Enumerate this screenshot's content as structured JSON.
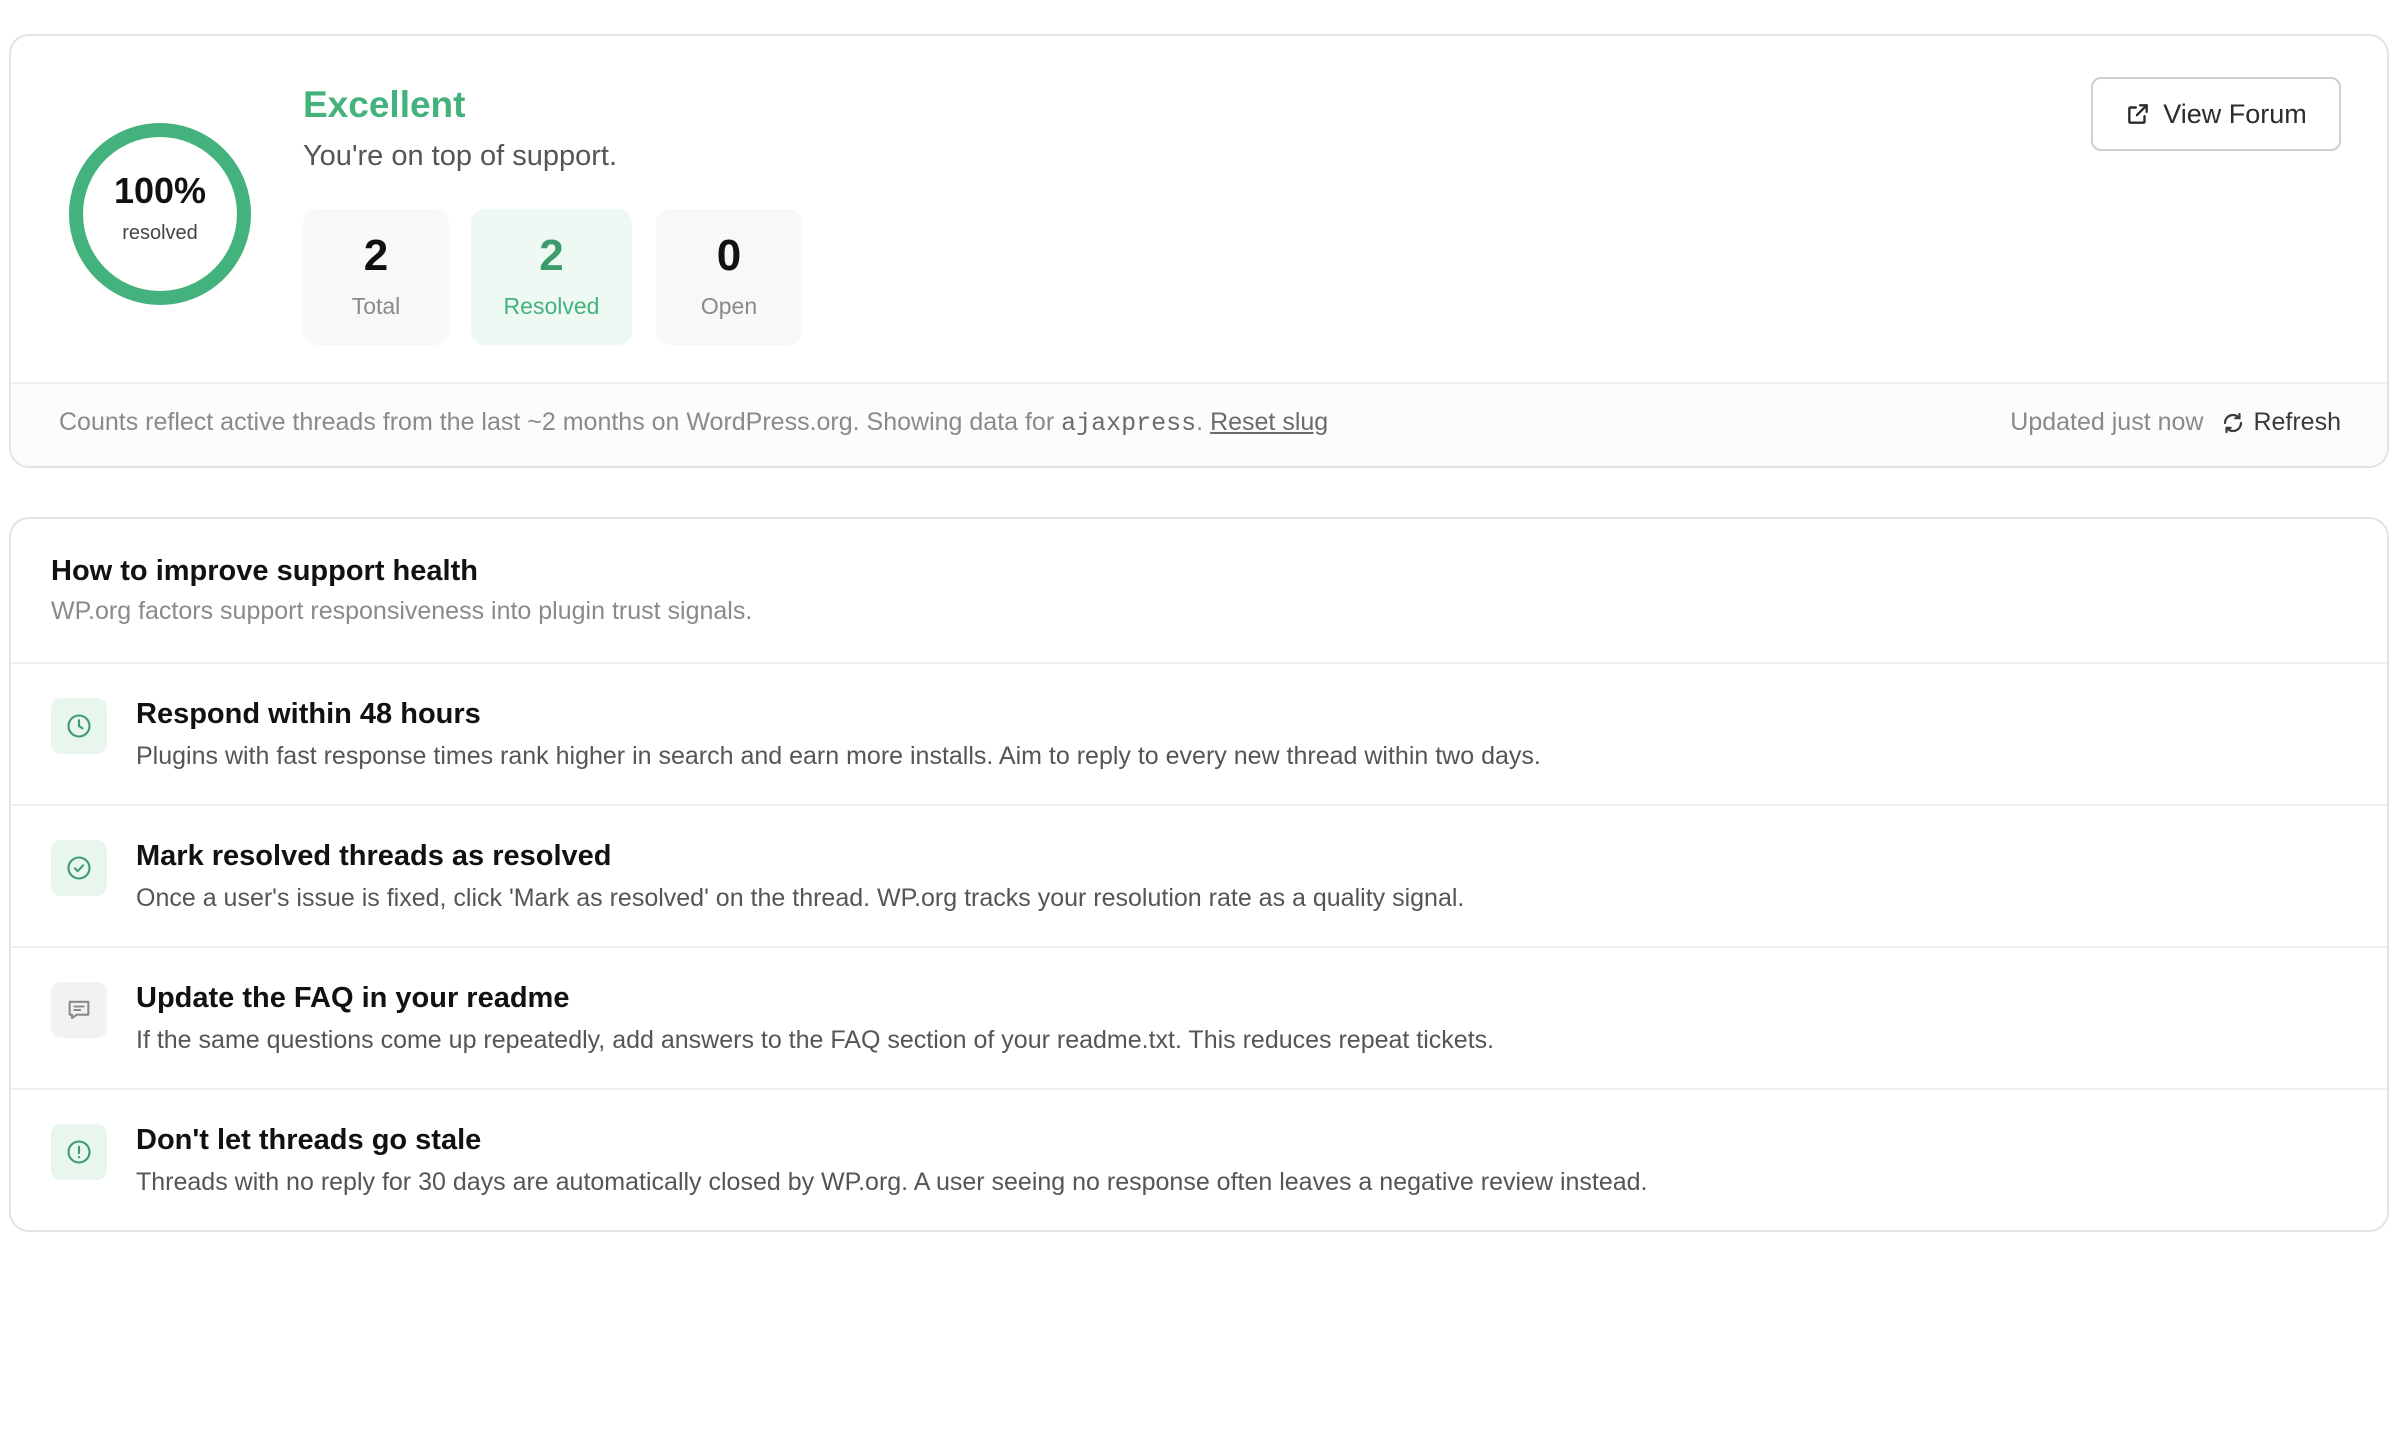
{
  "summary": {
    "ring_percent": "100%",
    "ring_sub": "resolved",
    "resolved_fraction": 1.0,
    "status_title": "Excellent",
    "status_subtitle": "You're on top of support.",
    "stats": {
      "total": {
        "value": "2",
        "label": "Total"
      },
      "resolved": {
        "value": "2",
        "label": "Resolved"
      },
      "open": {
        "value": "0",
        "label": "Open"
      }
    },
    "view_forum_label": "View Forum",
    "footer": {
      "note_prefix": "Counts reflect active threads from the last ~2 months on WordPress.org. Showing data for ",
      "slug": "ajaxpress",
      "note_suffix": ". ",
      "reset_label": "Reset slug",
      "updated": "Updated just now",
      "refresh_label": "Refresh"
    }
  },
  "tips": {
    "title": "How to improve support health",
    "subtitle": "WP.org factors support responsiveness into plugin trust signals.",
    "items": [
      {
        "icon": "clock-icon",
        "title": "Respond within 48 hours",
        "description": "Plugins with fast response times rank higher in search and earn more installs. Aim to reply to every new thread within two days."
      },
      {
        "icon": "check-circle-icon",
        "title": "Mark resolved threads as resolved",
        "description": "Once a user's issue is fixed, click 'Mark as resolved' on the thread. WP.org tracks your resolution rate as a quality signal."
      },
      {
        "icon": "chat-bubble-icon",
        "title": "Update the FAQ in your readme",
        "description": "If the same questions come up repeatedly, add answers to the FAQ section of your readme.txt. This reduces repeat tickets."
      },
      {
        "icon": "alert-circle-icon",
        "title": "Don't let threads go stale",
        "description": "Threads with no reply for 30 days are automatically closed by WP.org. A user seeing no response often leaves a negative review instead."
      }
    ]
  },
  "colors": {
    "accent_green": "#44b27c",
    "ring_track": "#e6f4ec",
    "resolved_bg": "#edf9f2"
  }
}
